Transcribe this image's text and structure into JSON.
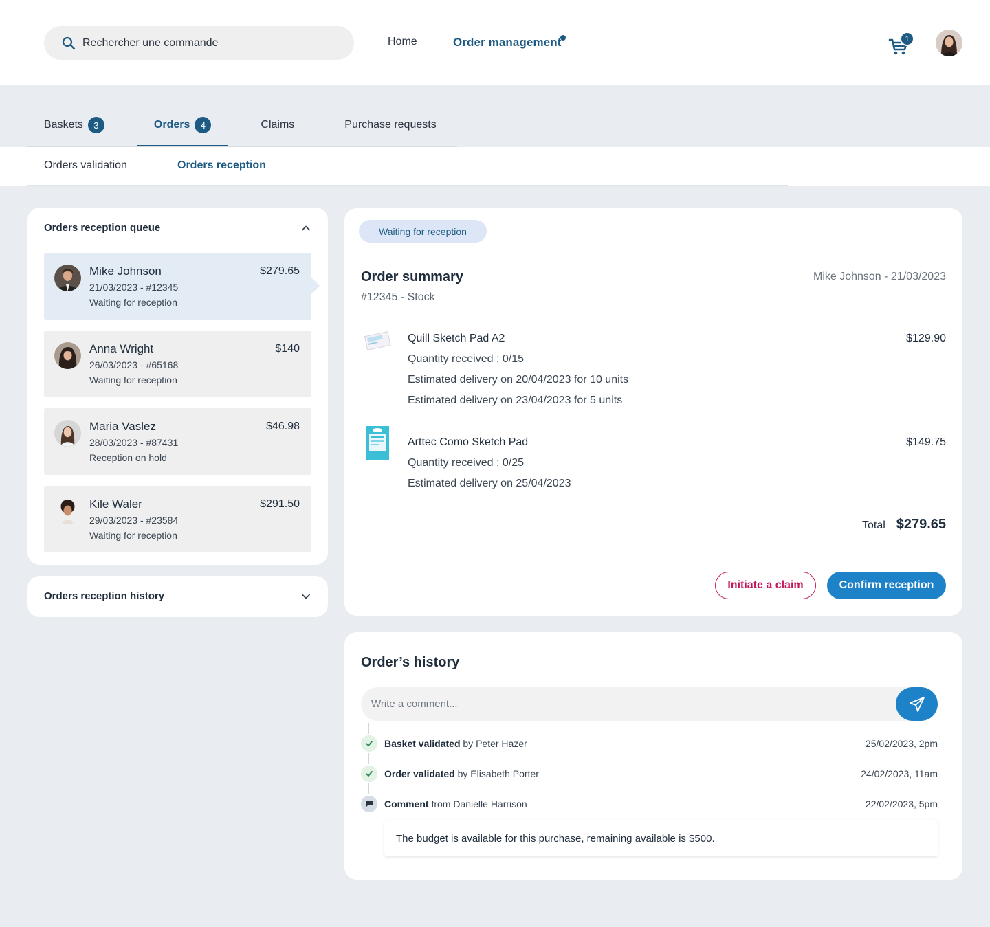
{
  "header": {
    "search_placeholder": "Rechercher une commande",
    "nav": {
      "home": "Home",
      "order_management": "Order management"
    },
    "cart_count": "1",
    "icons": {
      "search": "search-icon",
      "cart": "cart-icon",
      "avatar": "user-avatar"
    }
  },
  "tabs": [
    {
      "label": "Baskets",
      "badge": "3"
    },
    {
      "label": "Orders",
      "badge": "4"
    },
    {
      "label": "Claims"
    },
    {
      "label": "Purchase requests"
    }
  ],
  "subtabs": {
    "validation": "Orders validation",
    "reception": "Orders reception"
  },
  "queue": {
    "title": "Orders reception queue",
    "items": [
      {
        "name": "Mike Johnson",
        "meta": "21/03/2023 - #12345",
        "status": "Waiting for reception",
        "price": "$279.65"
      },
      {
        "name": "Anna Wright",
        "meta": "26/03/2023 - #65168",
        "status": "Waiting for reception",
        "price": "$140"
      },
      {
        "name": "Maria Vaslez",
        "meta": "28/03/2023 - #87431",
        "status": "Reception on hold",
        "price": "$46.98"
      },
      {
        "name": "Kile Waler",
        "meta": "29/03/2023 - #23584",
        "status": "Waiting for reception",
        "price": "$291.50"
      }
    ]
  },
  "history_panel": {
    "title": "Orders reception history"
  },
  "summary": {
    "status": "Waiting for reception",
    "title": "Order summary",
    "subtitle": "#12345 - Stock",
    "customer_date": "Mike Johnson - 21/03/2023",
    "products": [
      {
        "name": "Quill Sketch Pad A2",
        "price": "$129.90",
        "lines": [
          "Quantity received : 0/15",
          "Estimated delivery on 20/04/2023 for 10 units",
          "Estimated delivery on 23/04/2023 for 5 units"
        ]
      },
      {
        "name": "Arttec Como Sketch Pad",
        "price": "$149.75",
        "lines": [
          "Quantity received : 0/25",
          "Estimated delivery on 25/04/2023"
        ]
      }
    ],
    "total_label": "Total",
    "total_value": "$279.65",
    "buttons": {
      "claim": "Initiate a claim",
      "confirm": "Confirm reception"
    }
  },
  "order_history": {
    "title": "Order’s history",
    "comment_placeholder": "Write a comment...",
    "events": [
      {
        "action": "Basket validated",
        "by": "by Peter Hazer",
        "date": "25/02/2023, 2pm"
      },
      {
        "action": "Order validated",
        "by": "by Elisabeth Porter",
        "date": "24/02/2023, 11am"
      },
      {
        "action": "Comment",
        "by": "from Danielle Harrison",
        "date": "22/02/2023, 5pm"
      }
    ],
    "comment_text": "The budget is available for this purchase, remaining available is $500."
  },
  "colors": {
    "primary": "#1e5b84",
    "accent_button": "#1e82c8",
    "claim": "#c2185b",
    "background": "#e9edf1"
  }
}
